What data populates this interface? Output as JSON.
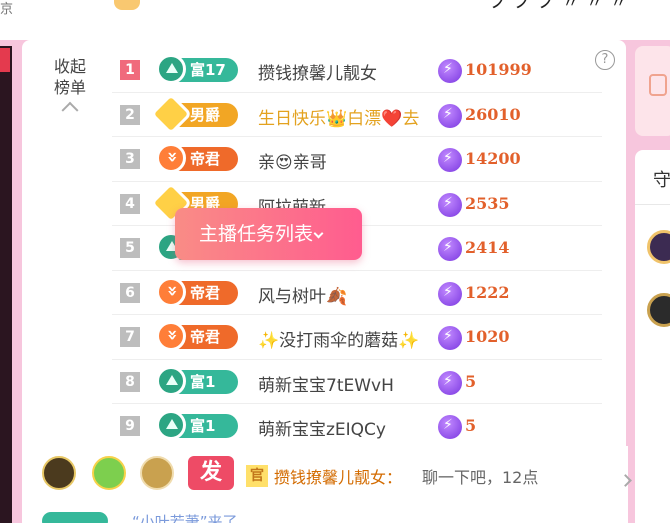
{
  "topbar": {
    "left_char": "京"
  },
  "ranking": {
    "collapse_label": "收起榜单",
    "help_label": "?",
    "rows": [
      {
        "rank": "1",
        "badge_label": "富17",
        "badge_type": "fu",
        "name": "攒钱撩馨儿靓女",
        "score": "101999"
      },
      {
        "rank": "2",
        "badge_label": "男爵",
        "badge_type": "nan",
        "name": "生日快乐👑白漂❤️去",
        "score": "26010"
      },
      {
        "rank": "3",
        "badge_label": "帝君",
        "badge_type": "di",
        "name": "亲😍亲哥",
        "score": "14200"
      },
      {
        "rank": "4",
        "badge_label": "男爵",
        "badge_type": "nan",
        "name": "阿拉萌新",
        "score": "2535"
      },
      {
        "rank": "5",
        "badge_label": "",
        "badge_type": "fu",
        "name": "",
        "score": "2414"
      },
      {
        "rank": "6",
        "badge_label": "帝君",
        "badge_type": "di",
        "name": "风与树叶🍂",
        "score": "1222"
      },
      {
        "rank": "7",
        "badge_label": "帝君",
        "badge_type": "di",
        "name": "✨没打雨伞的蘑菇✨",
        "score": "1020"
      },
      {
        "rank": "8",
        "badge_label": "富1",
        "badge_type": "fu",
        "name": "萌新宝宝7tEWvH",
        "score": "5"
      },
      {
        "rank": "9",
        "badge_label": "富1",
        "badge_type": "fu",
        "name": "萌新宝宝zEIQCy",
        "score": "5"
      }
    ]
  },
  "tooltip": {
    "label": "主播任务列表"
  },
  "chat": {
    "fa_label": "发",
    "guan_label": "官",
    "message_user": "攒钱撩馨儿靓女：",
    "message_text": "聊一下吧，12点",
    "second_line": "“小叶若萧”来了"
  },
  "right_panel": {
    "tab_label": "守"
  }
}
